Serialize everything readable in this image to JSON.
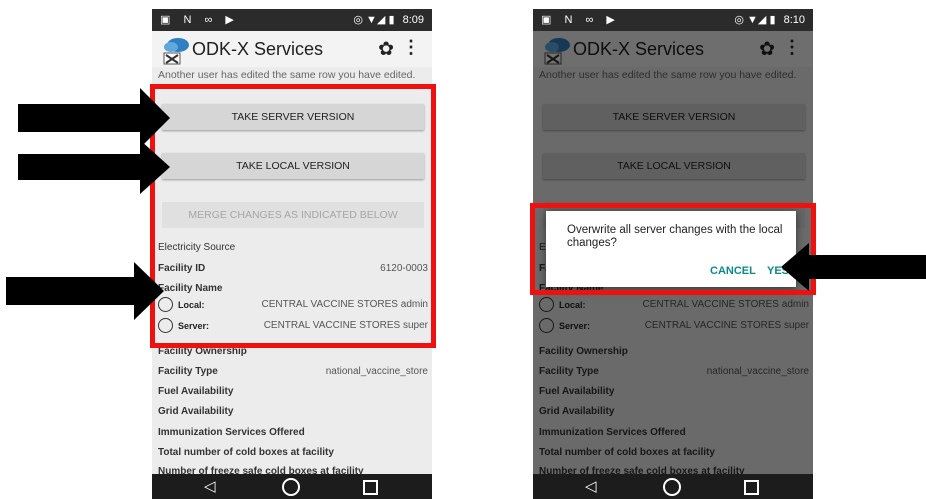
{
  "status_bar": {
    "left_icons": "▣ N ∞ ▶",
    "left_time": "8:09",
    "right_time": "8:10",
    "icons": "◎ ▼◢ ▮"
  },
  "app": {
    "title": "ODK-X Services",
    "logo_icon": "odk-x-cloud-logo-icon",
    "settings_icon": "gear-icon",
    "menu_icon": "overflow-menu-icon"
  },
  "conflict_message": "Another user has edited the same row you have edited.",
  "buttons": {
    "take_server": "TAKE SERVER VERSION",
    "take_local": "TAKE LOCAL VERSION",
    "merge": "MERGE CHANGES AS INDICATED BELOW"
  },
  "fields": {
    "electricity_source": "Electricity Source",
    "facility_id_label": "Facility ID",
    "facility_id_value": "6120-0003",
    "facility_name_label": "Facility Name",
    "local_label": "Local:",
    "local_value": "CENTRAL VACCINE STORES admin",
    "server_label": "Server:",
    "server_value": "CENTRAL VACCINE STORES super",
    "facility_ownership": "Facility Ownership",
    "facility_type_label": "Facility Type",
    "facility_type_value": "national_vaccine_store",
    "fuel_availability": "Fuel Availability",
    "grid_availability": "Grid Availability",
    "immunization_services": "Immunization Services Offered",
    "total_cold_boxes": "Total number of cold boxes at facility",
    "freeze_safe_cold_boxes": "Number of freeze safe cold boxes at facility"
  },
  "dialog": {
    "message": "Overwrite all server changes with the local changes?",
    "cancel": "CANCEL",
    "yes": "YES"
  },
  "nav": {
    "back_icon": "◁"
  },
  "colors": {
    "highlight_red": "#ef1010",
    "dialog_accent": "#0b8a8a",
    "arrow": "#000000"
  }
}
